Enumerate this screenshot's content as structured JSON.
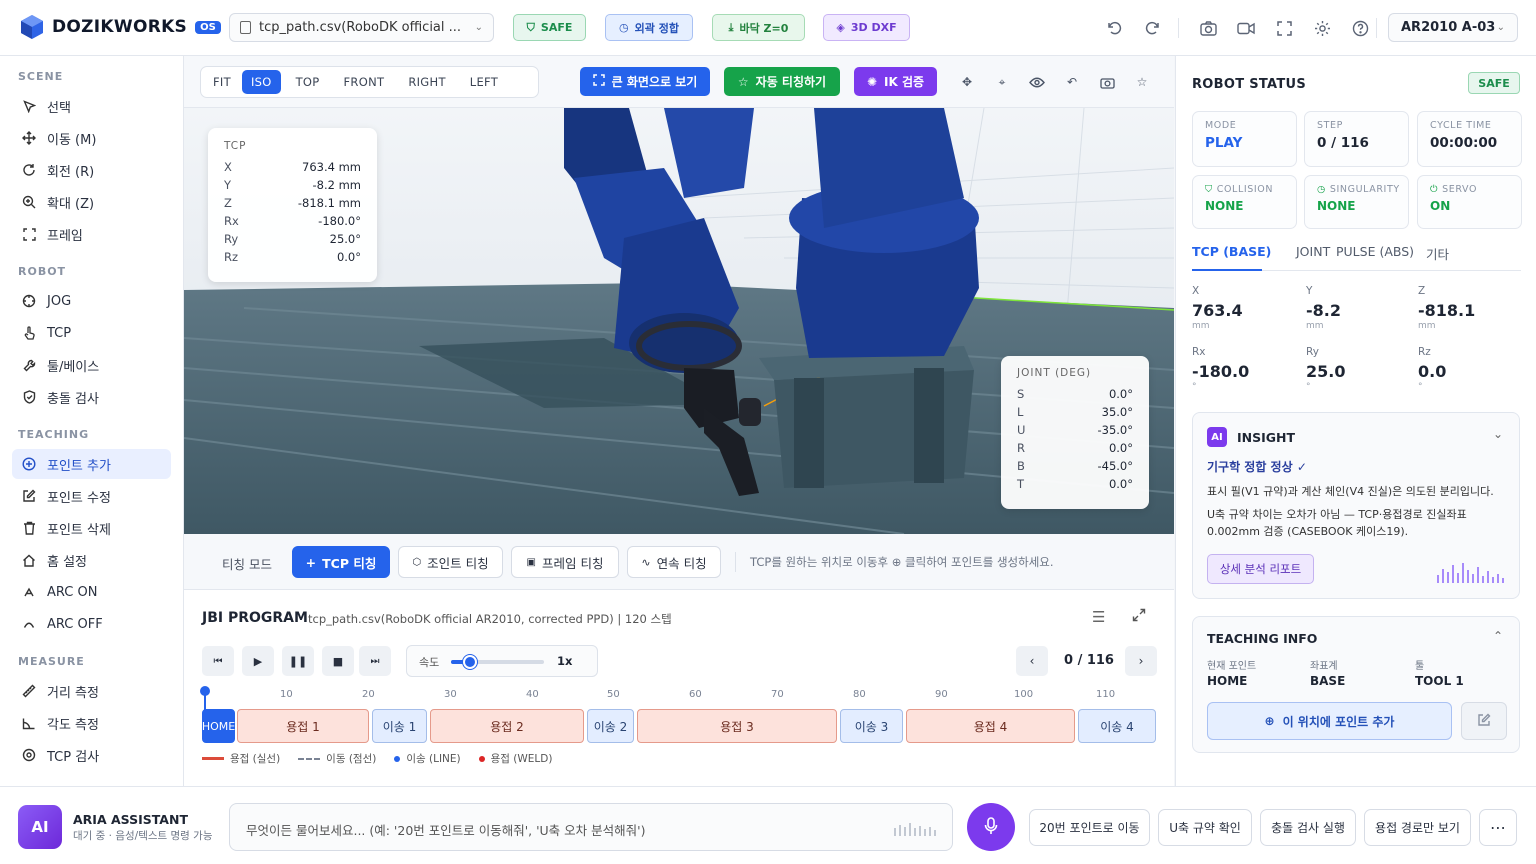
{
  "header": {
    "logo": "DOZIKWORKS",
    "version": "OS",
    "file": "tcp_path.csv(RoboDK official ...",
    "chips": {
      "safe": "SAFE",
      "ext": "외곽 정합",
      "floor": "바닥 Z=0",
      "dxf": "3D DXF"
    },
    "robot": "AR2010 A-03"
  },
  "sidebar": {
    "scene_title": "SCENE",
    "scene": [
      "선택",
      "이동 (M)",
      "회전 (R)",
      "확대 (Z)",
      "프레임"
    ],
    "robot_title": "ROBOT",
    "robot": [
      "JOG",
      "TCP",
      "툴/베이스",
      "충돌 검사"
    ],
    "teaching_title": "TEACHING",
    "teaching": [
      "포인트 추가",
      "포인트 수정",
      "포인트 삭제",
      "홈 설정",
      "ARC ON",
      "ARC OFF"
    ],
    "measure_title": "MEASURE",
    "measure": [
      "거리 측정",
      "각도 측정",
      "TCP 검사"
    ]
  },
  "viewport": {
    "views": [
      "FIT",
      "ISO",
      "TOP",
      "FRONT",
      "RIGHT",
      "LEFT"
    ],
    "active_view": "ISO",
    "fullscreen": "큰 화면으로 보기",
    "auto_teach": "자동 티칭하기",
    "ik": "IK 검증",
    "tcp": {
      "title": "TCP",
      "rows": [
        {
          "k": "X",
          "v": "763.4 mm"
        },
        {
          "k": "Y",
          "v": "-8.2 mm"
        },
        {
          "k": "Z",
          "v": "-818.1 mm"
        },
        {
          "k": "Rx",
          "v": "-180.0°"
        },
        {
          "k": "Ry",
          "v": "25.0°"
        },
        {
          "k": "Rz",
          "v": "0.0°"
        }
      ]
    },
    "joint": {
      "title": "JOINT (DEG)",
      "rows": [
        {
          "k": "S",
          "v": "0.0°"
        },
        {
          "k": "L",
          "v": "35.0°"
        },
        {
          "k": "U",
          "v": "-35.0°"
        },
        {
          "k": "R",
          "v": "0.0°"
        },
        {
          "k": "B",
          "v": "-45.0°"
        },
        {
          "k": "T",
          "v": "0.0°"
        }
      ]
    }
  },
  "teach_bar": {
    "mode": "티칭 모드",
    "tcp": "TCP 티칭",
    "joint": "조인트 티칭",
    "frame": "프레임 티칭",
    "cont": "연속 티칭",
    "hint": "TCP를 원하는 위치로 이동후 ⊕ 클릭하여 포인트를 생성하세요."
  },
  "program": {
    "title": "JBI PROGRAM",
    "subtitle": "tcp_path.csv(RoboDK official AR2010, corrected PPD) | 120 스텝",
    "speed_label": "속도",
    "speed_value": "1x",
    "speed_fraction": 0.2,
    "step": "0 / 116",
    "ticks": [
      "10",
      "20",
      "30",
      "40",
      "50",
      "60",
      "70",
      "80",
      "90",
      "100",
      "110"
    ],
    "segments": [
      {
        "label": "HOME",
        "kind": "home"
      },
      {
        "label": "용접 1",
        "kind": "weld"
      },
      {
        "label": "이송 1",
        "kind": "mv"
      },
      {
        "label": "용접 2",
        "kind": "weld"
      },
      {
        "label": "이송 2",
        "kind": "mv"
      },
      {
        "label": "용접 3",
        "kind": "weld"
      },
      {
        "label": "이송 3",
        "kind": "mv"
      },
      {
        "label": "용접 4",
        "kind": "weld"
      },
      {
        "label": "이송 4",
        "kind": "mv"
      }
    ],
    "legend": {
      "weld_line": "용접 (실선)",
      "move_line": "이동 (점선)",
      "line_dot": "이송 (LINE)",
      "weld_dot": "용접 (WELD)"
    }
  },
  "robot_status": {
    "title": "ROBOT STATUS",
    "badge": "SAFE",
    "mode_l": "MODE",
    "mode_v": "PLAY",
    "step_l": "STEP",
    "step_v": "0 / 116",
    "cycle_l": "CYCLE TIME",
    "cycle_v": "00:00:00",
    "coll_l": "COLLISION",
    "coll_v": "NONE",
    "sing_l": "SINGULARITY",
    "sing_v": "NONE",
    "servo_l": "SERVO",
    "servo_v": "ON",
    "tabs": [
      "TCP (BASE)",
      "JOINT",
      "PULSE (ABS)",
      "기타"
    ],
    "coords": [
      {
        "l": "X",
        "v": "763.4",
        "u": "mm"
      },
      {
        "l": "Y",
        "v": "-8.2",
        "u": "mm"
      },
      {
        "l": "Z",
        "v": "-818.1",
        "u": "mm"
      },
      {
        "l": "Rx",
        "v": "-180.0",
        "u": "°"
      },
      {
        "l": "Ry",
        "v": "25.0",
        "u": "°"
      },
      {
        "l": "Rz",
        "v": "0.0",
        "u": "°"
      }
    ]
  },
  "insight": {
    "badge": "AI",
    "title": "INSIGHT",
    "status": "기구학 정합 정상 ✓",
    "p1": "표시 필(V1 규약)과 계산 체인(V4 진실)은 의도된 분리입니다.",
    "p2": "U축 규약 차이는 오차가 아님 — TCP·용접경로 진실좌표 0.002mm 검증 (CASEBOOK 케이스19).",
    "report": "상세 분석 리포트"
  },
  "teaching_info": {
    "title": "TEACHING INFO",
    "cur_l": "현재 포인트",
    "cur_v": "HOME",
    "coord_l": "좌표계",
    "coord_v": "BASE",
    "tool_l": "툴",
    "tool_v": "TOOL 1",
    "add": "이 위치에 포인트 추가"
  },
  "assistant": {
    "avatar": "AI",
    "name": "ARIA ASSISTANT",
    "status": "대기 중 · 음성/텍스트 명령 가능",
    "placeholder": "무엇이든 물어보세요... (예: '20번 포인트로 이동해줘', 'U축 오차 분석해줘')",
    "quick": [
      "20번 포인트로 이동",
      "U축 규약 확인",
      "충돌 검사 실행",
      "용접 경로만 보기"
    ]
  },
  "colors": {
    "accent": "#2563eb",
    "green": "#16a34a",
    "purple": "#7c3aed",
    "robot": "#1d3f9a",
    "floor": "#4e6774"
  }
}
